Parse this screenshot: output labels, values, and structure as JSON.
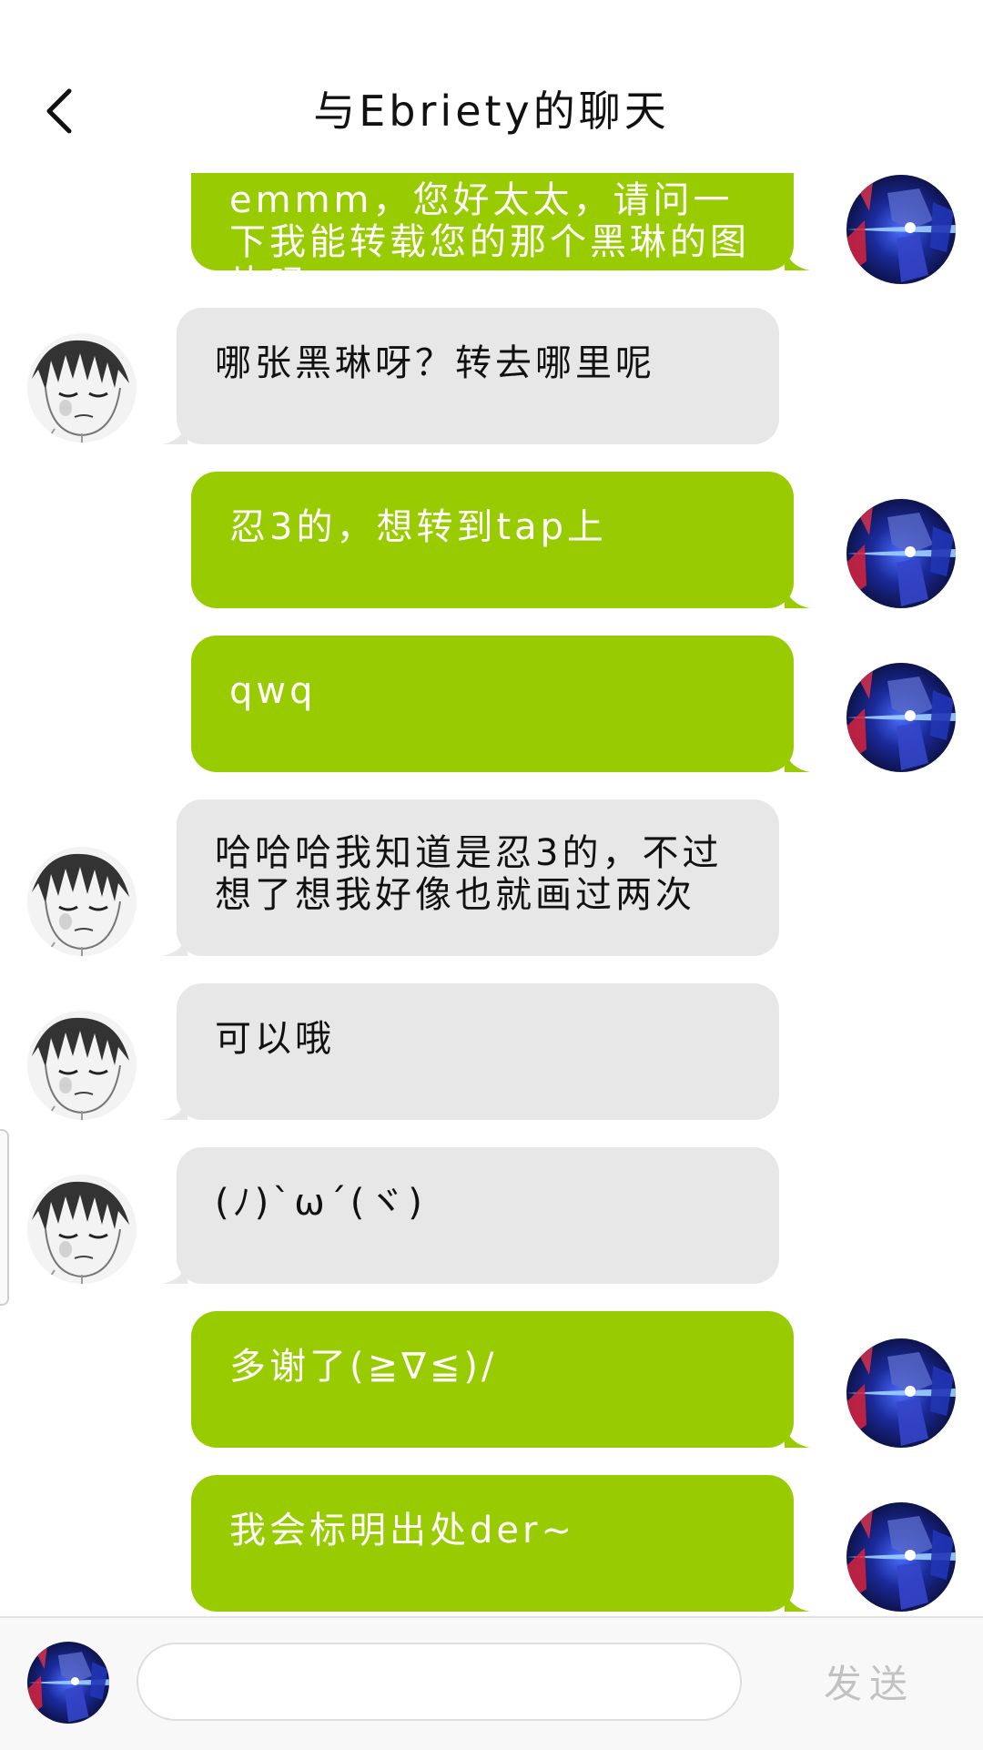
{
  "header": {
    "title": "与Ebriety的聊天"
  },
  "messages": [
    {
      "from": "me",
      "text": "emmm，您好太太，请问一下我能转载您的那个黑琳的图片吗"
    },
    {
      "from": "other",
      "text": "哪张黑琳呀？转去哪里呢"
    },
    {
      "from": "me",
      "text": "忍3的，想转到tap上"
    },
    {
      "from": "me",
      "text": "qwq"
    },
    {
      "from": "other",
      "text": "哈哈哈我知道是忍3的，不过想了想我好像也就画过两次"
    },
    {
      "from": "other",
      "text": "可以哦"
    },
    {
      "from": "other",
      "text": "(ﾉ)`ω´(ヾ)"
    },
    {
      "from": "me",
      "text": "多谢了(≧∇≦)/"
    },
    {
      "from": "me",
      "text": "我会标明出处der~"
    }
  ],
  "input_bar": {
    "placeholder": "",
    "send_label": "发送"
  },
  "colors": {
    "sent_bubble": "#99cc00",
    "received_bubble": "#e7e7e7",
    "send_label": "#c2c2c2"
  },
  "icons": {
    "back": "chevron-left-icon",
    "my_avatar": "robot-avatar",
    "other_avatar": "sketch-face-avatar"
  }
}
